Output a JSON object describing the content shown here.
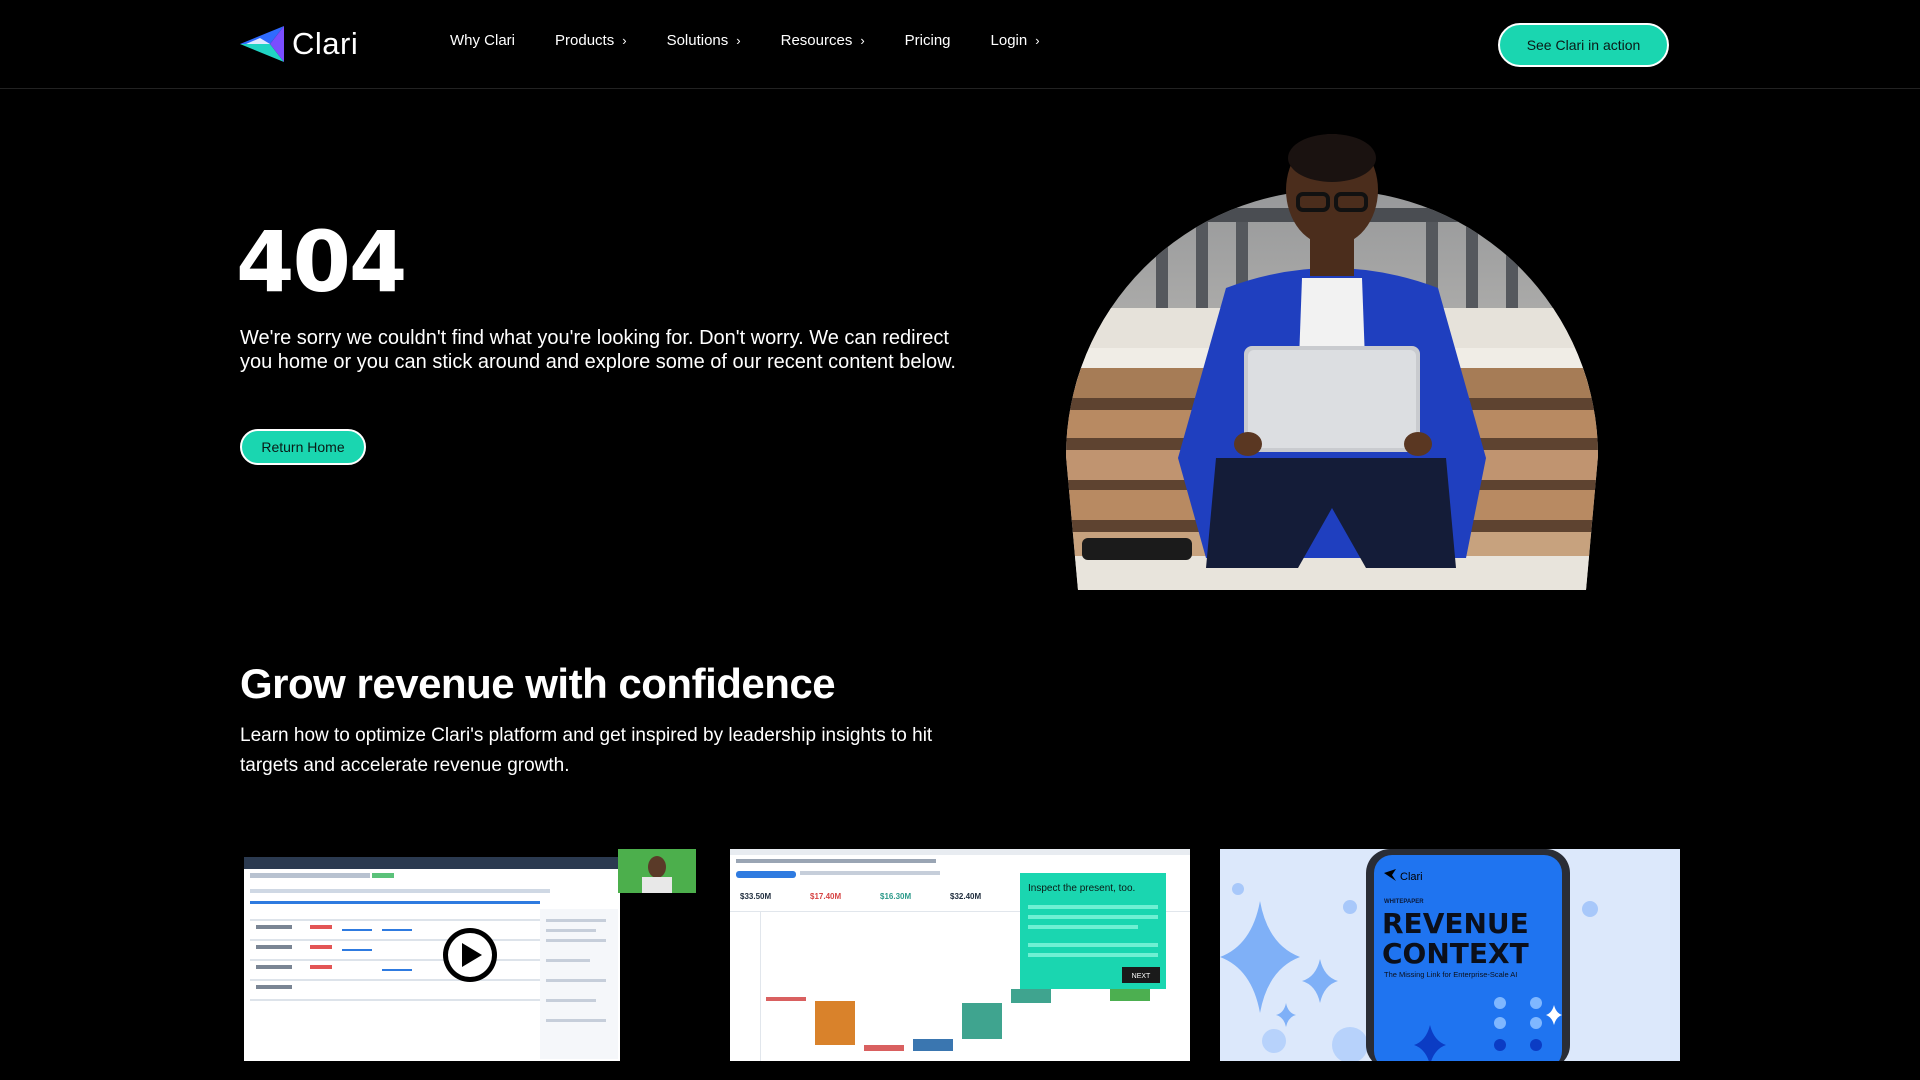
{
  "nav": {
    "logo_text": "Clari",
    "links": [
      {
        "label": "Why Clari",
        "has_chevron": false
      },
      {
        "label": "Products",
        "has_chevron": true
      },
      {
        "label": "Solutions",
        "has_chevron": true
      },
      {
        "label": "Resources",
        "has_chevron": true
      },
      {
        "label": "Pricing",
        "has_chevron": false
      },
      {
        "label": "Login",
        "has_chevron": true
      }
    ],
    "chevron_glyph": "›",
    "cta_label": "See Clari in action"
  },
  "hero": {
    "error_code": "404",
    "message": "We're sorry we couldn't find what you're looking for. Don't worry. We can redirect you home or you can stick around and explore some of our recent content below.",
    "return_label": "Return Home"
  },
  "section": {
    "title": "Grow revenue with confidence",
    "description": "Learn how to optimize Clari's platform and get inspired by leadership insights to hit targets and accelerate revenue growth."
  },
  "cards": {
    "card2": {
      "popup_text": "Inspect the present, too.",
      "next_label": "NEXT",
      "metrics": [
        "$33.50M",
        "$17.40M",
        "$16.30M",
        "$32.40M"
      ]
    },
    "card3": {
      "brand": "Clari",
      "kicker": "WHITEPAPER",
      "title_line1": "REVENUE",
      "title_line2": "CONTEXT",
      "subtitle": "The Missing Link for Enterprise-Scale AI"
    }
  },
  "colors": {
    "accent": "#1ad6b0",
    "background": "#000000",
    "text": "#ffffff",
    "logo_blue": "#2f6bff",
    "logo_cyan": "#20d4c4",
    "logo_purple": "#7a4dff"
  },
  "icons": {
    "play": "play-icon",
    "chevron": "chevron-right-icon"
  }
}
